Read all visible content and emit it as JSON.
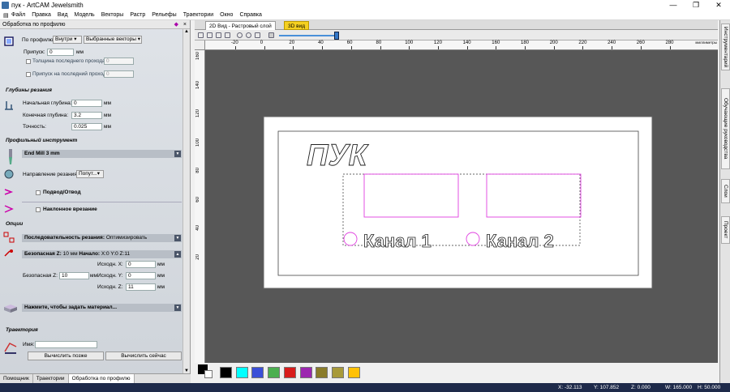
{
  "app": {
    "title": "пук - ArtCAM Jewelsmith",
    "min": "—",
    "restore": "❐",
    "close": "✕"
  },
  "menu": [
    "Файл",
    "Правка",
    "Вид",
    "Модель",
    "Векторы",
    "Растр",
    "Рельефы",
    "Траектории",
    "Окно",
    "Справка"
  ],
  "panel": {
    "title": "Обработка по профилю",
    "profile_label": "По профилю",
    "profile_side": "Внутри",
    "profile_vectors": "Выбранные векторы",
    "allowance_label": "Припуск:",
    "allowance_value": "0",
    "mm": "мм",
    "last_pass_thickness": "Толщина последнего прохода",
    "last_pass_value": "0",
    "last_pass_allowance": "Припуск на последний проход",
    "last_pass_allowance_value": "0",
    "depth_section": "Глубины резания",
    "start_depth_label": "Начальная глубина:",
    "start_depth": "0",
    "end_depth_label": "Конечная глубина:",
    "end_depth": "3.2",
    "tolerance_label": "Точность:",
    "tolerance": "0.025",
    "tool_section": "Профильный инструмент",
    "tool_name": "End Mill 3 mm",
    "cut_direction_label": "Направление резания:",
    "cut_direction": "Попут...",
    "lead_label": "Подвод/Отвод",
    "ramp_label": "Наклонное врезание",
    "options_section": "Опции",
    "sequence_label": "Последовательность резания:",
    "sequence_value": "Оптимизировать",
    "safe_z_summary_label": "Безопасная Z:",
    "safe_z_summary": "10 мм",
    "start_label": "Начало:",
    "start_summary": "X:0 Y:0 Z:11",
    "home_x_label": "Исходн. X:",
    "home_x": "0",
    "safe_z_label": "Безопасная Z:",
    "safe_z": "10",
    "home_y_label": "Исходн. Y:",
    "home_y": "0",
    "home_z_label": "Исходн. Z:",
    "home_z": "11",
    "material_label": "Нажмите, чтобы задать материал...",
    "toolpath_section": "Траектория",
    "name_label": "Имя:",
    "name_value": "",
    "calc_later": "Вычислить позже",
    "calc_now": "Вычислить сейчас"
  },
  "bottom_tabs": [
    "Помощник",
    "Траектории",
    "Обработка по профилю"
  ],
  "doc_tabs": [
    "2D Вид - Растровый слой",
    "3D вид"
  ],
  "ruler_h": [
    "-20",
    "0",
    "20",
    "40",
    "60",
    "80",
    "100",
    "120",
    "140",
    "160",
    "180",
    "200",
    "220",
    "240",
    "260",
    "280"
  ],
  "ruler_v": [
    "160",
    "140",
    "120",
    "100",
    "80",
    "60",
    "40",
    "20"
  ],
  "ruler_unit": "миллиметры",
  "canvas_texts": {
    "title_text": "ПУК",
    "channel1": "Канал 1",
    "channel2": "Канал 2"
  },
  "palette": [
    "#000000",
    "#ffffff",
    "#000000",
    "#00ffff",
    "#3b4fd8",
    "#4caf50",
    "#d81b1b",
    "#9c27b0",
    "#8a7c2a",
    "#a89a3a",
    "#ffc107"
  ],
  "right_tabs": [
    "Инструментарий",
    "Обучающие руководства",
    "Слои",
    "Проект"
  ],
  "status": {
    "x": "X: -32.113",
    "y": "Y: 107.852",
    "z": "Z: 0.000",
    "w": "W: 165.000",
    "h": "H: 50.000"
  }
}
